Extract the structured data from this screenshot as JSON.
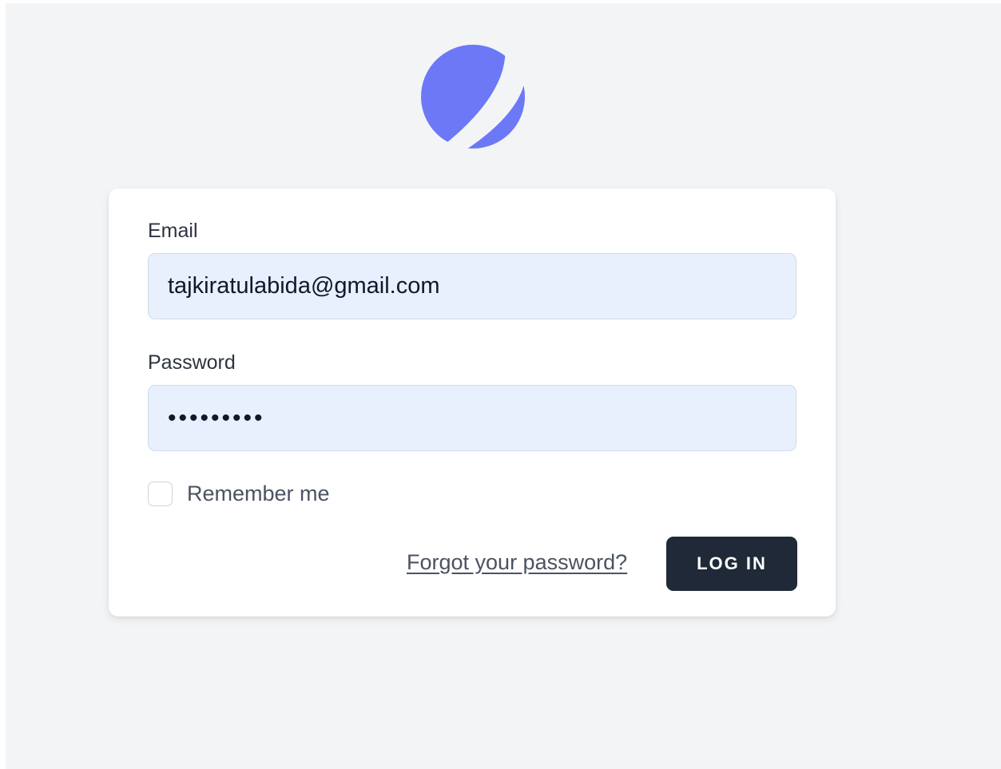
{
  "brand": {
    "logo_icon": "crescent-orb-logo",
    "accent_color": "#6c78f6"
  },
  "form": {
    "email_label": "Email",
    "email_value": "tajkiratulabida@gmail.com",
    "password_label": "Password",
    "password_value": "•••••••••",
    "remember_label": "Remember me",
    "remember_checked": false,
    "forgot_label": "Forgot your password?",
    "login_label": "LOG IN"
  },
  "colors": {
    "page_background": "#f3f4f6",
    "card_background": "#ffffff",
    "input_background": "#e8effd",
    "button_background": "#1f2937"
  }
}
